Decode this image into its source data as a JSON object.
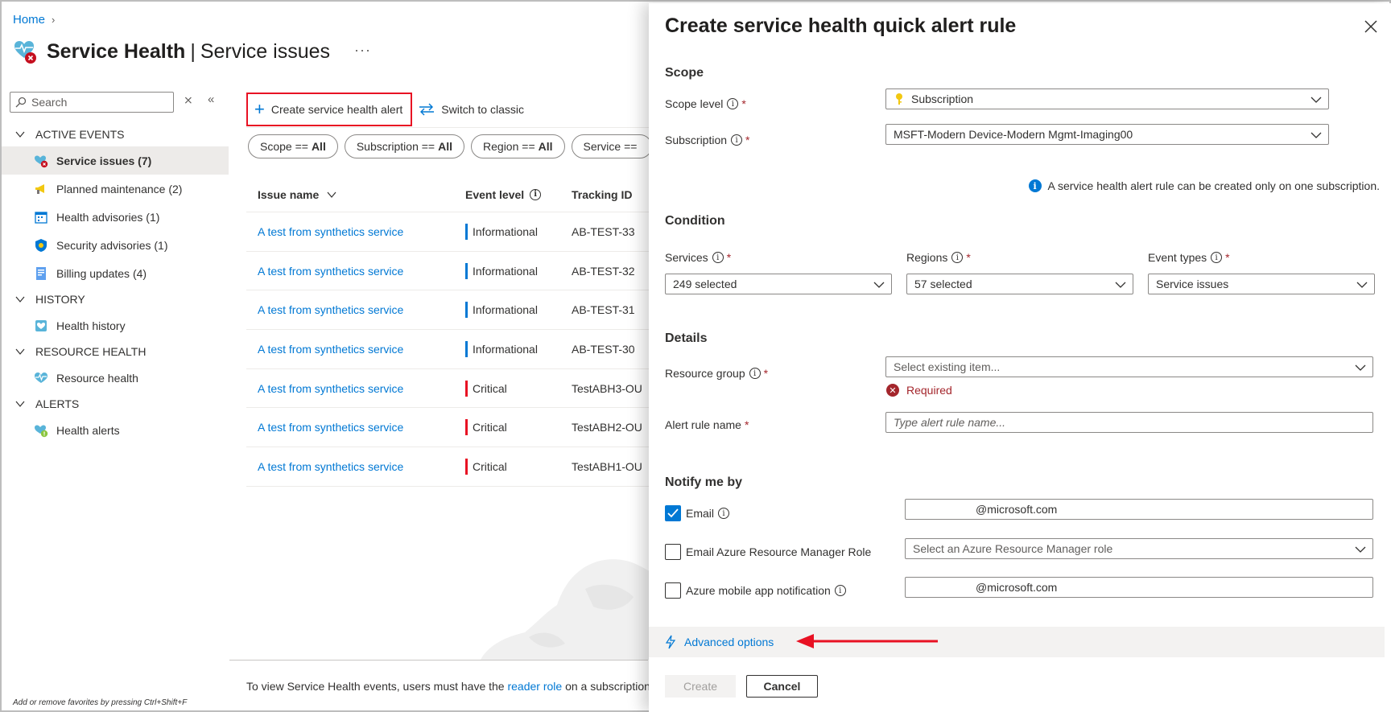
{
  "breadcrumb": {
    "home": "Home"
  },
  "page": {
    "title": "Service Health",
    "subtitle": "Service issues",
    "more": "···"
  },
  "sidebar": {
    "search_placeholder": "Search",
    "groups": [
      {
        "label": "ACTIVE EVENTS"
      },
      {
        "label": "HISTORY"
      },
      {
        "label": "RESOURCE HEALTH"
      },
      {
        "label": "ALERTS"
      }
    ],
    "items": [
      {
        "label": "Service issues (7)",
        "icon": "service-issues-icon"
      },
      {
        "label": "Planned maintenance (2)",
        "icon": "megaphone-icon"
      },
      {
        "label": "Health advisories (1)",
        "icon": "calendar-advisory-icon"
      },
      {
        "label": "Security advisories (1)",
        "icon": "shield-icon"
      },
      {
        "label": "Billing updates (4)",
        "icon": "billing-icon"
      },
      {
        "label": "Health history",
        "icon": "health-history-icon"
      },
      {
        "label": "Resource health",
        "icon": "heart-pulse-icon"
      },
      {
        "label": "Health alerts",
        "icon": "health-alerts-icon"
      }
    ],
    "favorites_hint": "Add or remove favorites by pressing Ctrl+Shift+F"
  },
  "toolbar": {
    "create_label": "Create service health alert",
    "switch_label": "Switch to classic"
  },
  "filters": [
    {
      "key": "Scope ==",
      "value": "All"
    },
    {
      "key": "Subscription ==",
      "value": "All"
    },
    {
      "key": "Region ==",
      "value": "All"
    },
    {
      "key": "Service ==",
      "value": ""
    }
  ],
  "grid": {
    "headers": {
      "issue": "Issue name",
      "level": "Event level",
      "tracking": "Tracking ID"
    },
    "rows": [
      {
        "issue": "A test from synthetics service",
        "level": "Informational",
        "tracking": "AB-TEST-33"
      },
      {
        "issue": "A test from synthetics service",
        "level": "Informational",
        "tracking": "AB-TEST-32"
      },
      {
        "issue": "A test from synthetics service",
        "level": "Informational",
        "tracking": "AB-TEST-31"
      },
      {
        "issue": "A test from synthetics service",
        "level": "Informational",
        "tracking": "AB-TEST-30"
      },
      {
        "issue": "A test from synthetics service",
        "level": "Critical",
        "tracking": "TestABH3-OU"
      },
      {
        "issue": "A test from synthetics service",
        "level": "Critical",
        "tracking": "TestABH2-OU"
      },
      {
        "issue": "A test from synthetics service",
        "level": "Critical",
        "tracking": "TestABH1-OU"
      }
    ]
  },
  "footer": {
    "note_prefix": "To view Service Health events, users must have the ",
    "note_link": "reader role",
    "note_suffix": " on a subscription"
  },
  "panel": {
    "title": "Create service health quick alert rule",
    "scope": {
      "section": "Scope",
      "scope_level_label": "Scope level",
      "scope_level_value": "Subscription",
      "subscription_label": "Subscription",
      "subscription_value": "MSFT-Modern Device-Modern Mgmt-Imaging00",
      "note": "A service health alert rule can be created only on one subscription."
    },
    "condition": {
      "section": "Condition",
      "services_label": "Services",
      "services_value": "249 selected",
      "regions_label": "Regions",
      "regions_value": "57 selected",
      "event_types_label": "Event types",
      "event_types_value": "Service issues"
    },
    "details": {
      "section": "Details",
      "resource_group_label": "Resource group",
      "resource_group_placeholder": "Select existing item...",
      "required_error": "Required",
      "alert_rule_name_label": "Alert rule name",
      "alert_rule_name_placeholder": "Type alert rule name..."
    },
    "notify": {
      "section": "Notify me by",
      "email_label": "Email",
      "email_checked": true,
      "email_value": "@microsoft.com",
      "arm_role_label": "Email Azure Resource Manager Role",
      "arm_role_checked": false,
      "arm_role_placeholder": "Select an Azure Resource Manager role",
      "mobile_label": "Azure mobile app notification",
      "mobile_checked": false,
      "mobile_value": "@microsoft.com"
    },
    "advanced_options": "Advanced options",
    "create_button": "Create",
    "cancel_button": "Cancel"
  },
  "colors": {
    "accent": "#0078d4",
    "critical": "#e81123",
    "highlight": "#e81123",
    "required": "#a4262c"
  }
}
